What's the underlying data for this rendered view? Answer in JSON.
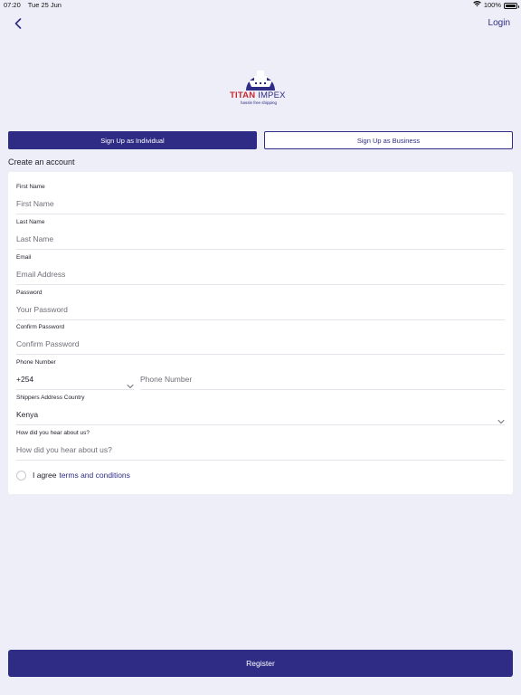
{
  "status_bar": {
    "time": "07:20",
    "date": "Tue 25 Jun",
    "battery": "100%"
  },
  "nav": {
    "back_icon": "chevron-left-icon",
    "login_label": "Login"
  },
  "logo": {
    "text_bold": "TITAN",
    "text_light": "IMPEX",
    "tagline": "hassle free shipping",
    "colors": {
      "red": "#c8282d",
      "blue": "#2e2c84"
    }
  },
  "tabs": [
    {
      "label": "Sign Up as Individual",
      "selected": true
    },
    {
      "label": "Sign Up as Business",
      "selected": false
    }
  ],
  "form": {
    "title": "Create an account",
    "fields": {
      "first_name": {
        "label": "First Name",
        "placeholder": "First Name"
      },
      "last_name": {
        "label": "Last Name",
        "placeholder": "Last Name"
      },
      "email": {
        "label": "Email",
        "placeholder": "Email Address"
      },
      "password": {
        "label": "Password",
        "placeholder": "Your Password"
      },
      "confirm_password": {
        "label": "Confirm Password",
        "placeholder": "Confirm Password"
      },
      "phone": {
        "label": "Phone Number",
        "country_code": "+254",
        "placeholder": "Phone Number"
      },
      "country": {
        "label": "Shippers Address Country",
        "value": "Kenya"
      },
      "referral": {
        "label": "How did you hear about us?",
        "placeholder": "How did you hear about us?"
      }
    },
    "agree_text": "I agree",
    "terms_link": "terms and conditions"
  },
  "register_label": "Register",
  "colors": {
    "primary": "#2e2c84",
    "background": "#eeeef8",
    "card": "#ffffff"
  }
}
